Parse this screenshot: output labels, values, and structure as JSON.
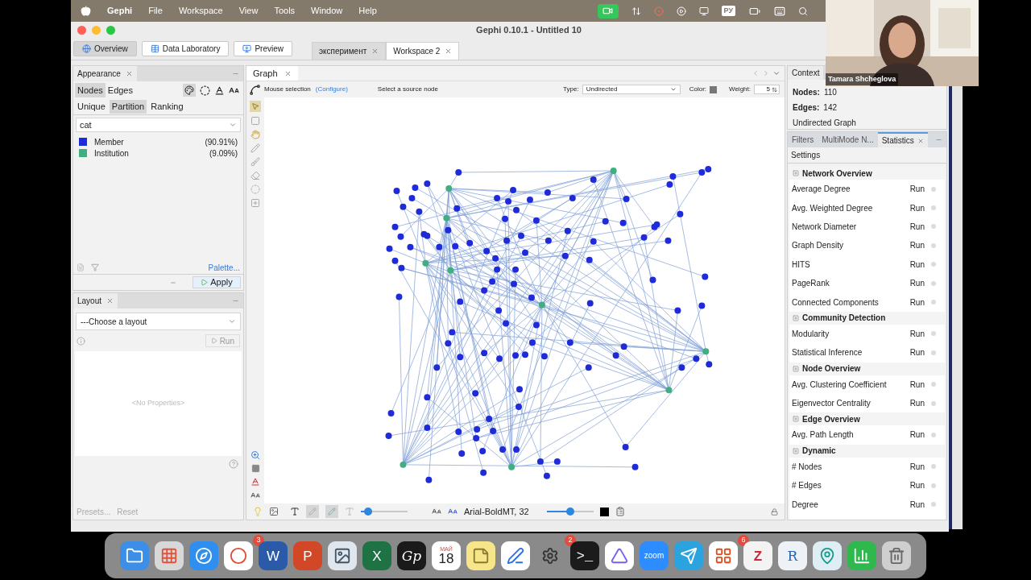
{
  "menu_bar": {
    "app": "Gephi",
    "menus": [
      "File",
      "Workspace",
      "View",
      "Tools",
      "Window",
      "Help"
    ],
    "input_source": "РУ"
  },
  "webcam": {
    "name": "Tamara Shcheglova"
  },
  "window": {
    "title": "Gephi 0.10.1 - Untitled 10"
  },
  "modes": [
    {
      "label": "Overview",
      "selected": true
    },
    {
      "label": "Data Laboratory",
      "selected": false
    },
    {
      "label": "Preview",
      "selected": false
    }
  ],
  "workspaces": [
    {
      "label": "эксперимент",
      "selected": false
    },
    {
      "label": "Workspace 2",
      "selected": true
    }
  ],
  "appearance": {
    "title": "Appearance",
    "element_tabs": [
      {
        "label": "Nodes",
        "selected": true
      },
      {
        "label": "Edges",
        "selected": false
      }
    ],
    "method_tabs": [
      {
        "label": "Unique",
        "selected": false
      },
      {
        "label": "Partition",
        "selected": true
      },
      {
        "label": "Ranking",
        "selected": false
      }
    ],
    "attribute": "cat",
    "partitions": [
      {
        "label": "Member",
        "share": "(90.91%)",
        "color": "#1f2bd8"
      },
      {
        "label": "Institution",
        "share": "(9.09%)",
        "color": "#3fae80"
      }
    ],
    "palette_link": "Palette...",
    "apply": "Apply"
  },
  "layout": {
    "title": "Layout",
    "select": "---Choose a layout",
    "run": "Run",
    "empty": "<No Properties>",
    "presets": "Presets...",
    "reset": "Reset"
  },
  "graph": {
    "title": "Graph",
    "tool": "Mouse selection",
    "configure": "(Configure)",
    "hint": "Select a source node",
    "type_label": "Type:",
    "type": "Undirected",
    "color_label": "Color:",
    "weight_label": "Weight:",
    "weight": "5",
    "node_size_slider": {
      "level": 0.15
    },
    "font": "Arial-BoldMT, 32",
    "label_size_slider": {
      "level": 0.5
    }
  },
  "context": {
    "title": "Context",
    "stats": [
      {
        "label": "Nodes:",
        "value": "110"
      },
      {
        "label": "Edges:",
        "value": "142"
      }
    ],
    "graph_type": "Undirected Graph"
  },
  "statistics": {
    "tabs": [
      {
        "label": "Filters",
        "selected": false
      },
      {
        "label": "MultiMode N...",
        "selected": false
      },
      {
        "label": "Statistics",
        "selected": true
      }
    ],
    "settings": "Settings",
    "groups": [
      {
        "title": "Network Overview",
        "items": [
          {
            "name": "Average Degree",
            "action": "Run"
          },
          {
            "name": "Avg. Weighted Degree",
            "action": "Run"
          },
          {
            "name": "Network Diameter",
            "action": "Run"
          },
          {
            "name": "Graph Density",
            "action": "Run"
          },
          {
            "name": "HITS",
            "action": "Run"
          },
          {
            "name": "PageRank",
            "action": "Run"
          },
          {
            "name": "Connected Components",
            "action": "Run"
          }
        ]
      },
      {
        "title": "Community Detection",
        "items": [
          {
            "name": "Modularity",
            "action": "Run"
          },
          {
            "name": "Statistical Inference",
            "action": "Run"
          }
        ]
      },
      {
        "title": "Node Overview",
        "items": [
          {
            "name": "Avg. Clustering Coefficient",
            "action": "Run"
          },
          {
            "name": "Eigenvector Centrality",
            "action": "Run"
          }
        ]
      },
      {
        "title": "Edge Overview",
        "items": [
          {
            "name": "Avg. Path Length",
            "action": "Run"
          }
        ]
      },
      {
        "title": "Dynamic",
        "items": [
          {
            "name": "# Nodes",
            "action": "Run"
          },
          {
            "name": "# Edges",
            "action": "Run"
          },
          {
            "name": "Degree",
            "action": "Run"
          }
        ]
      }
    ]
  },
  "dock": [
    {
      "kind": "finder"
    },
    {
      "kind": "launchpad"
    },
    {
      "kind": "safari"
    },
    {
      "kind": "chrome",
      "badge": "3"
    },
    {
      "kind": "word",
      "glyph": "W"
    },
    {
      "kind": "powerpoint",
      "glyph": "P"
    },
    {
      "kind": "preview"
    },
    {
      "kind": "excel",
      "glyph": "X"
    },
    {
      "kind": "gephi",
      "glyph": "Gp"
    },
    {
      "kind": "calendar",
      "glyph": "18",
      "month": "МАЙ"
    },
    {
      "kind": "notes"
    },
    {
      "kind": "freeform"
    },
    {
      "kind": "settings",
      "badge": "2"
    },
    {
      "kind": "terminal",
      "glyph": ">_"
    },
    {
      "kind": "clickup"
    },
    {
      "kind": "zoom",
      "glyph": "zoom"
    },
    {
      "kind": "telegram"
    },
    {
      "kind": "office",
      "badge": "6"
    },
    {
      "kind": "zotero",
      "glyph": "Z"
    },
    {
      "kind": "r",
      "glyph": "R"
    },
    {
      "kind": "heatmap"
    },
    {
      "kind": "numbers"
    },
    {
      "kind": "trash"
    }
  ]
}
